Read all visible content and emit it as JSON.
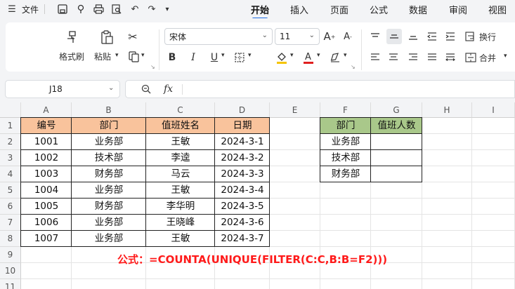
{
  "menu": {
    "file_label": "文件",
    "tabs": [
      {
        "label": "开始",
        "active": true
      },
      {
        "label": "插入"
      },
      {
        "label": "页面"
      },
      {
        "label": "公式"
      },
      {
        "label": "数据"
      },
      {
        "label": "审阅"
      },
      {
        "label": "视图"
      }
    ]
  },
  "ribbon": {
    "format_painter": "格式刷",
    "paste": "粘贴",
    "font_name": "宋体",
    "font_size": "11",
    "wrap_text": "换行",
    "merge": "合并"
  },
  "formula_bar": {
    "name_box": "J18",
    "fx": "fx",
    "content": ""
  },
  "sheet": {
    "columns": [
      "A",
      "B",
      "C",
      "D",
      "E",
      "F",
      "G",
      "H",
      "I"
    ],
    "rows": [
      "1",
      "2",
      "3",
      "4",
      "5",
      "6",
      "7",
      "8",
      "9",
      "10",
      "11"
    ],
    "table1": {
      "headers": [
        "编号",
        "部门",
        "值班姓名",
        "日期"
      ],
      "rows": [
        [
          "1001",
          "业务部",
          "王敏",
          "2024-3-1"
        ],
        [
          "1002",
          "技术部",
          "李逵",
          "2024-3-2"
        ],
        [
          "1003",
          "财务部",
          "马云",
          "2024-3-3"
        ],
        [
          "1004",
          "业务部",
          "王敏",
          "2024-3-4"
        ],
        [
          "1005",
          "财务部",
          "李华明",
          "2024-3-5"
        ],
        [
          "1006",
          "业务部",
          "王晓峰",
          "2024-3-6"
        ],
        [
          "1007",
          "业务部",
          "王敏",
          "2024-3-7"
        ]
      ]
    },
    "table2": {
      "headers": [
        "部门",
        "值班人数"
      ],
      "rows": [
        [
          "业务部",
          ""
        ],
        [
          "技术部",
          ""
        ],
        [
          "财务部",
          ""
        ]
      ]
    },
    "formula_note": "公式：=COUNTA(UNIQUE(FILTER(C:C,B:B=F2)))"
  },
  "colors": {
    "header_orange": "#f9c39c",
    "header_green": "#a9c88a",
    "accent": "#1f6fe5",
    "note_red": "#ff1a1a"
  }
}
